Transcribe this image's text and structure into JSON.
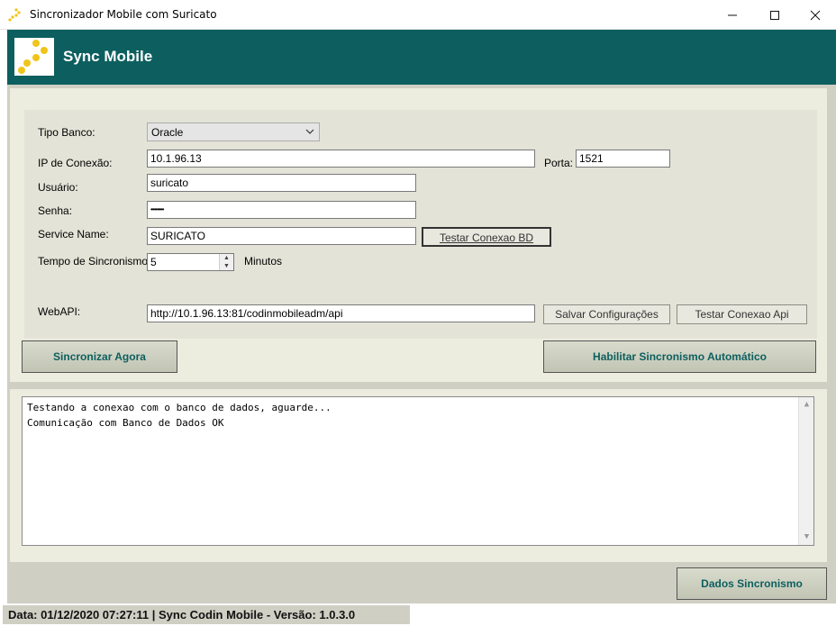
{
  "window": {
    "title": "Sincronizador Mobile com Suricato"
  },
  "header": {
    "app_title": "Sync Mobile"
  },
  "form": {
    "tipo_banco_label": "Tipo Banco:",
    "tipo_banco_value": "Oracle",
    "ip_label": "IP de Conexão:",
    "ip_value": "10.1.96.13",
    "porta_label": "Porta:",
    "porta_value": "1521",
    "usuario_label": "Usuário:",
    "usuario_value": "suricato",
    "senha_label": "Senha:",
    "senha_value": "••••••••",
    "service_name_label": "Service Name:",
    "service_name_value": "SURICATO",
    "testar_bd_label": "Testar Conexao BD",
    "tempo_label": "Tempo de Sincronismo:",
    "tempo_value": "5",
    "minutos_label": "Minutos",
    "webapi_label": "WebAPI:",
    "webapi_value": "http://10.1.96.13:81/codinmobileadm/api",
    "salvar_label": "Salvar Configurações",
    "testar_api_label": "Testar Conexao Api"
  },
  "actions": {
    "sincronizar_label": "Sincronizar Agora",
    "habilitar_label": "Habilitar Sincronismo Automático",
    "dados_label": "Dados Sincronismo"
  },
  "log": {
    "lines": [
      "Testando a conexao com o banco de dados, aguarde...",
      "Comunicação com Banco de Dados OK"
    ]
  },
  "status": {
    "text": "Data:  01/12/2020 07:27:11  |  Sync Codin Mobile - Versão: 1.0.3.0"
  },
  "colors": {
    "header_bg": "#0d5f5f",
    "logo_dots": "#f0c419",
    "panel_bg": "#cfcfc4"
  }
}
